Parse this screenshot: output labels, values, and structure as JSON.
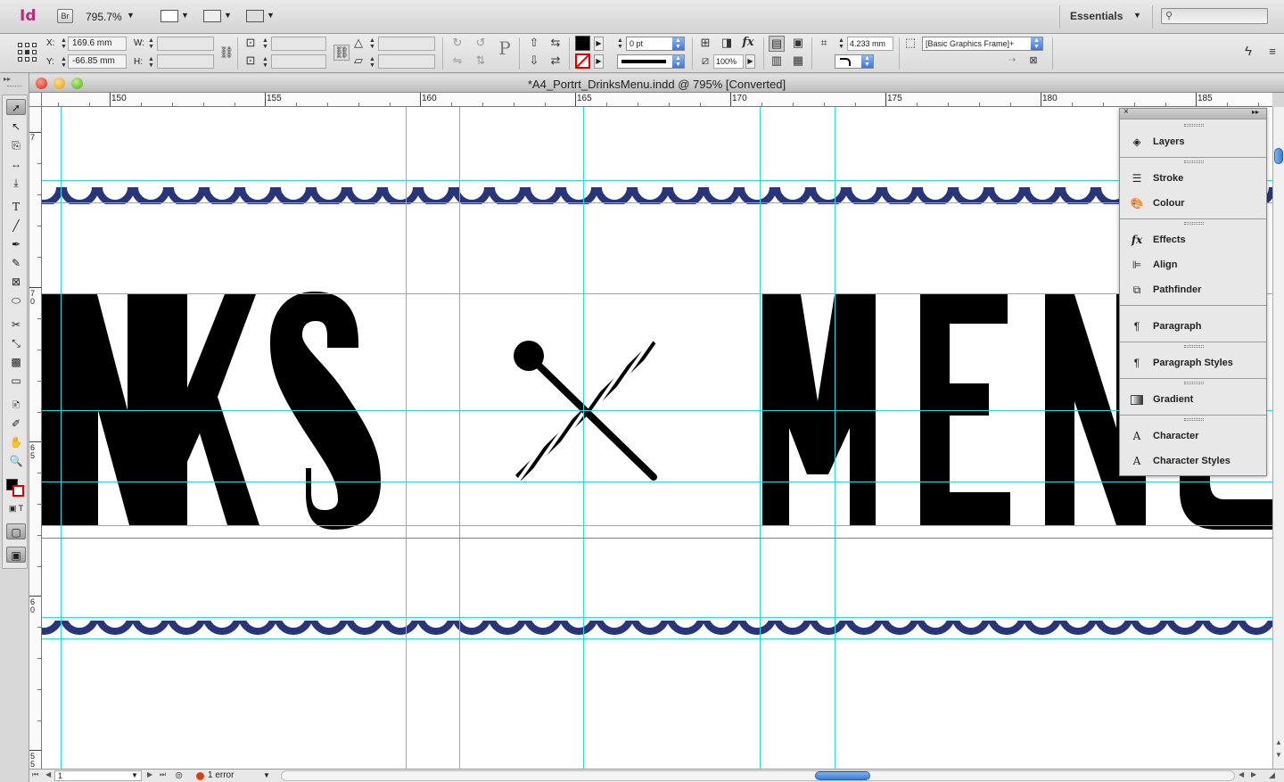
{
  "appbar": {
    "logo": "Id",
    "bridge": "Br",
    "zoom": "795.7%",
    "workspace": "Essentials"
  },
  "control": {
    "x_label": "X:",
    "x_value": "169.6 mm",
    "y_label": "Y:",
    "y_value": "-66.85 mm",
    "w_label": "W:",
    "h_label": "H:",
    "stroke_weight": "0 pt",
    "opacity": "100%",
    "corner_size": "4.233 mm",
    "object_style": "[Basic Graphics Frame]+"
  },
  "document": {
    "title": "*A4_Portrt_DrinksMenu.indd @ 795% [Converted]",
    "ruler_h": [
      "150",
      "155",
      "160",
      "165",
      "170",
      "175",
      "180",
      "185"
    ],
    "ruler_v": [
      "7",
      "7\n0",
      "6\n5",
      "6\n0",
      "5\n5"
    ]
  },
  "artwork": {
    "left_text": "NKS",
    "right_text": "MENU",
    "wave_color": "#283579"
  },
  "panel": {
    "items": [
      {
        "icon": "layers-icon",
        "label": "Layers"
      },
      {
        "icon": "stroke-icon",
        "label": "Stroke"
      },
      {
        "icon": "colour-icon",
        "label": "Colour"
      },
      {
        "icon": "effects-icon",
        "label": "Effects"
      },
      {
        "icon": "align-icon",
        "label": "Align"
      },
      {
        "icon": "pathfinder-icon",
        "label": "Pathfinder"
      },
      {
        "icon": "paragraph-icon",
        "label": "Paragraph"
      },
      {
        "icon": "paragraph-styles-icon",
        "label": "Paragraph Styles"
      },
      {
        "icon": "gradient-icon",
        "label": "Gradient"
      },
      {
        "icon": "character-icon",
        "label": "Character"
      },
      {
        "icon": "character-styles-icon",
        "label": "Character Styles"
      }
    ]
  },
  "status": {
    "page": "1",
    "errors": "1 error"
  }
}
